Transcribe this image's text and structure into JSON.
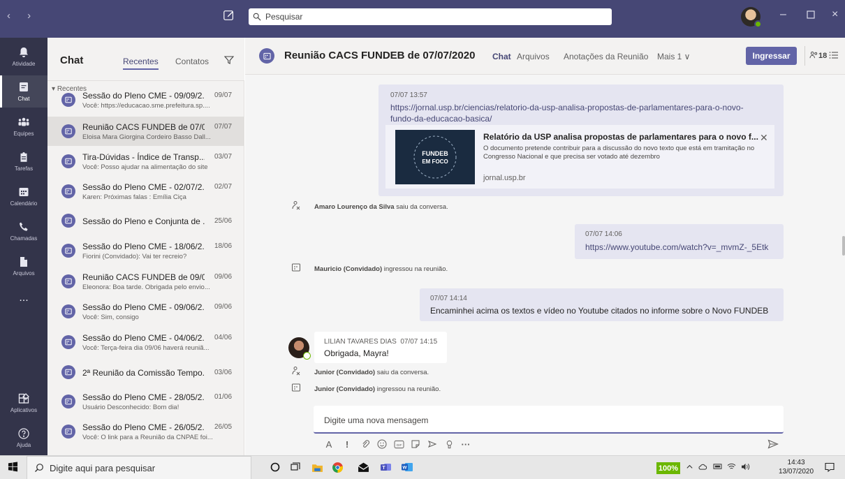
{
  "window": {
    "search_placeholder": "Pesquisar"
  },
  "rail": {
    "items": [
      {
        "label": "Atividade",
        "icon": "bell-icon"
      },
      {
        "label": "Chat",
        "icon": "chat-icon"
      },
      {
        "label": "Equipes",
        "icon": "teams-icon"
      },
      {
        "label": "Tarefas",
        "icon": "tasks-icon"
      },
      {
        "label": "Calendário",
        "icon": "calendar-icon"
      },
      {
        "label": "Chamadas",
        "icon": "phone-icon"
      },
      {
        "label": "Arquivos",
        "icon": "file-icon"
      },
      {
        "label": "Aplicativos",
        "icon": "apps-icon"
      },
      {
        "label": "Ajuda",
        "icon": "help-icon"
      }
    ],
    "more": "..."
  },
  "chatlist": {
    "title": "Chat",
    "tab_recent": "Recentes",
    "tab_contacts": "Contatos",
    "section": "Recentes",
    "items": [
      {
        "name": "Sessão do Pleno CME - 09/09/2...",
        "date": "09/07",
        "preview": "Você: https://educacao.sme.prefeitura.sp...."
      },
      {
        "name": "Reunião CACS FUNDEB de 07/0...",
        "date": "07/07",
        "preview": "Eloisa Mara Giorgina Cordeiro Basso Dall..."
      },
      {
        "name": "Tira-Dúvidas - Índice de Transp...",
        "date": "03/07",
        "preview": "Você: Posso ajudar na alimentação do site"
      },
      {
        "name": "Sessão do Pleno CME - 02/07/2...",
        "date": "02/07",
        "preview": "Karen: Próximas falas : Emília Ciça"
      },
      {
        "name": "Sessão do Pleno e Conjunta de ...",
        "date": "25/06",
        "preview": ""
      },
      {
        "name": "Sessão do Pleno CME - 18/06/2...",
        "date": "18/06",
        "preview": "Fiorini (Convidado): Vai ter recreio?"
      },
      {
        "name": "Reunião CACS FUNDEB de 09/0...",
        "date": "09/06",
        "preview": "Eleonora: Boa tarde. Obrigada pelo envio..."
      },
      {
        "name": "Sessão do Pleno CME - 09/06/2...",
        "date": "09/06",
        "preview": "Você: Sim, consigo"
      },
      {
        "name": "Sessão do Pleno CME - 04/06/2...",
        "date": "04/06",
        "preview": "Você: Terça-feira dia 09/06 haverá reuniã..."
      },
      {
        "name": "2ª Reunião da Comissão Tempo...",
        "date": "03/06",
        "preview": ""
      },
      {
        "name": "Sessão do Pleno CME - 28/05/2...",
        "date": "01/06",
        "preview": "Usuário Desconhecido: Bom dia!"
      },
      {
        "name": "Sessão do Pleno CME - 26/05/2...",
        "date": "26/05",
        "preview": "Você: O link para a Reunião da CNPAE foi..."
      }
    ]
  },
  "header": {
    "title": "Reunião CACS FUNDEB de 07/07/2020",
    "tab_chat": "Chat",
    "tab_files": "Arquivos",
    "tab_notes": "Anotações da Reunião",
    "tab_more": "Mais 1 ∨",
    "join": "Ingressar",
    "participants": "18"
  },
  "messages": {
    "m1_ts": "07/07 13:57",
    "m1_link1": "https://jornal.usp.br/ciencias/relatorio-da-usp-analisa-propostas-de-parlamentares-para-o-novo-",
    "m1_link2": "fundo-da-educacao-basica/",
    "card_title": "Relatório da USP analisa propostas de parlamentares para o novo f...",
    "card_desc": "O documento pretende contribuir para a discussão do novo texto que está em tramitação no Congresso Nacional e que precisa ser votado até dezembro",
    "card_domain": "jornal.usp.br",
    "card_img_text1": "FUNDEB",
    "card_img_text2": "EM FOCO",
    "ev1_name": "Amaro Lourenço da Silva",
    "ev1_text": " saiu da conversa.",
    "m2_ts": "07/07 14:06",
    "m2_link": "https://www.youtube.com/watch?v=_mvmZ-_5Etk",
    "ev2_name": "Mauricio (Convidado)",
    "ev2_text": " ingressou na reunião.",
    "m3_ts": "07/07 14:14",
    "m3_text": "Encaminhei acima os textos e vídeo no Youtube citados no informe sobre o Novo FUNDEB",
    "m4_author": "LILIAN TAVARES DIAS",
    "m4_ts": "07/07 14:15",
    "m4_text": "Obrigada, Mayra!",
    "ev3_name": "Junior (Convidado)",
    "ev3_text": " saiu da conversa.",
    "ev4_name": "Junior (Convidado)",
    "ev4_text": " ingressou na reunião."
  },
  "composer": {
    "placeholder": "Digite uma nova mensagem"
  },
  "taskbar": {
    "search": "Digite aqui para pesquisar",
    "battery": "100%",
    "time": "14:43",
    "date": "13/07/2020"
  },
  "colors": {
    "brand": "#6264a7",
    "titlebar": "#464775",
    "rail": "#33344a"
  }
}
